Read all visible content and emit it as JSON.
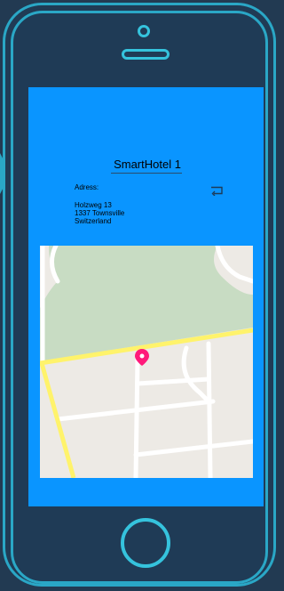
{
  "app": {
    "title": "SmartHotel 1"
  },
  "details": {
    "adress_label": "Adress:",
    "address_line1": "Holzweg 13",
    "address_line2": "1337 Townsville",
    "address_line3": "Switzerland"
  },
  "icons": {
    "back": "return-arrow-icon",
    "map_pin": "map-pin-icon"
  },
  "colors": {
    "screen_bg": "#0a95ff",
    "phone_outline": "#2aa7c6",
    "map_pin": "#ff1a7a",
    "highway": "#fff36b"
  }
}
